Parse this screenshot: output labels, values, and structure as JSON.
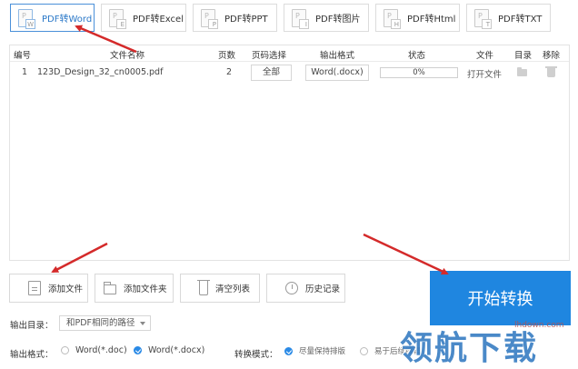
{
  "tabs": [
    {
      "label": "PDF转Word",
      "icon": "W",
      "active": true
    },
    {
      "label": "PDF转Excel",
      "icon": "E",
      "active": false
    },
    {
      "label": "PDF转PPT",
      "icon": "P",
      "active": false
    },
    {
      "label": "PDF转图片",
      "icon": "I",
      "active": false
    },
    {
      "label": "PDF转Html",
      "icon": "H",
      "active": false
    },
    {
      "label": "PDF转TXT",
      "icon": "T",
      "active": false
    }
  ],
  "table": {
    "headers": [
      "编号",
      "文件名称",
      "页数",
      "页码选择",
      "输出格式",
      "状态",
      "文件",
      "目录",
      "移除"
    ],
    "rows": [
      {
        "index": "1",
        "filename": "123D_Design_32_cn0005.pdf",
        "pages": "2",
        "page_select": "全部",
        "format": "Word(.docx)",
        "progress": 0,
        "status": "0%",
        "file_action": "打开文件"
      }
    ]
  },
  "actions": {
    "add_file": "添加文件",
    "add_folder": "添加文件夹",
    "clear_list": "清空列表",
    "history": "历史记录",
    "start": "开始转换"
  },
  "output": {
    "dir_label": "输出目录：",
    "dir_value": "和PDF相同的路径",
    "format_label": "输出格式：",
    "format_options": [
      {
        "label": "Word(*.doc)",
        "checked": false
      },
      {
        "label": "Word(*.docx)",
        "checked": true
      }
    ],
    "mode_label": "转换模式：",
    "mode_options": [
      {
        "label": "尽量保持排版",
        "checked": true
      },
      {
        "label": "易于后续编辑",
        "checked": false
      }
    ]
  },
  "watermark": {
    "url": "lhdown.com",
    "logo": "领航下载"
  },
  "colors": {
    "accent": "#1f86e0",
    "arrow": "#d42a2a",
    "active_tab": "#2a78c8"
  }
}
